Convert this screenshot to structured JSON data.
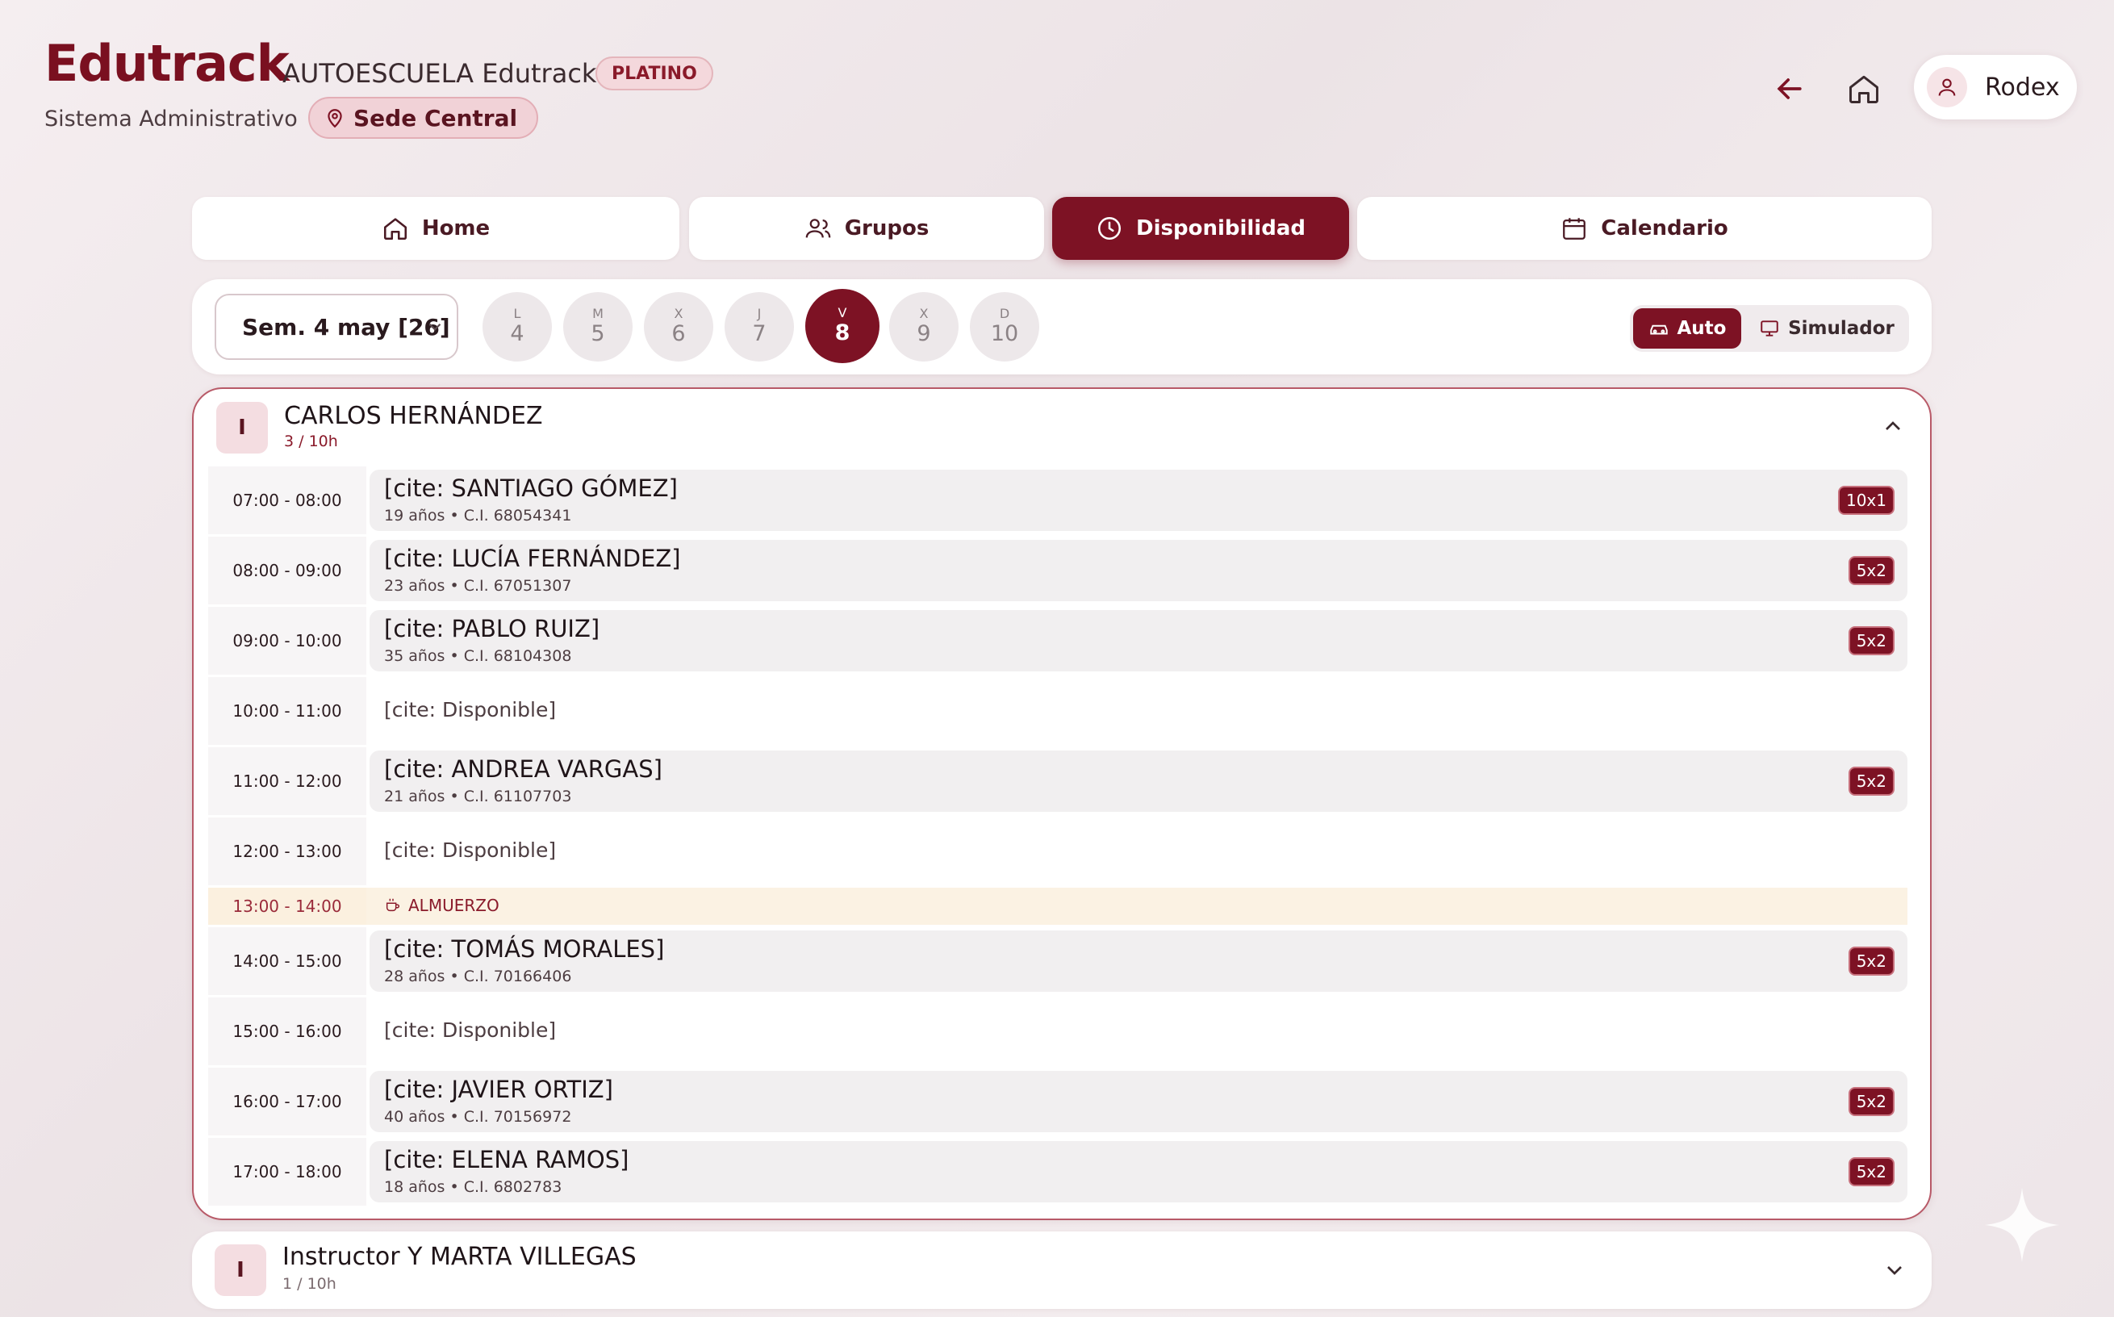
{
  "header": {
    "logo": "Edutrack",
    "school_name": "AUTOESCUELA Edutrack",
    "plan": "PLATINO",
    "subtitle": "Sistema Administrativo",
    "sede": "Sede Central",
    "user_name": "Rodex"
  },
  "tabs": [
    {
      "label": "Home",
      "icon": "home-icon"
    },
    {
      "label": "Grupos",
      "icon": "users-icon"
    },
    {
      "label": "Disponibilidad",
      "icon": "clock-icon",
      "active": true
    },
    {
      "label": "Calendario",
      "icon": "calendar-icon"
    }
  ],
  "week": {
    "selected": "Sem. 4 may [26]",
    "days": [
      {
        "letter": "L",
        "num": "4"
      },
      {
        "letter": "M",
        "num": "5"
      },
      {
        "letter": "X",
        "num": "6"
      },
      {
        "letter": "J",
        "num": "7"
      },
      {
        "letter": "V",
        "num": "8",
        "active": true
      },
      {
        "letter": "X",
        "num": "9"
      },
      {
        "letter": "D",
        "num": "10"
      }
    ]
  },
  "modes": {
    "auto": "Auto",
    "simulator": "Simulador"
  },
  "instructor1": {
    "initial": "I",
    "name": "CARLOS HERNÁNDEZ",
    "hours": "3 / 10h",
    "slots": [
      {
        "time": "07:00 - 08:00",
        "name": "[cite: SANTIAGO GÓMEZ]",
        "meta": "19 años • C.I. 68054341",
        "badge": "10x1"
      },
      {
        "time": "08:00 - 09:00",
        "name": "[cite: LUCÍA FERNÁNDEZ]",
        "meta": "23 años • C.I. 67051307",
        "badge": "5x2"
      },
      {
        "time": "09:00 - 10:00",
        "name": "[cite: PABLO RUIZ]",
        "meta": "35 años • C.I. 68104308",
        "badge": "5x2"
      },
      {
        "time": "10:00 - 11:00",
        "free": "[cite: Disponible]"
      },
      {
        "time": "11:00 - 12:00",
        "name": "[cite: ANDREA VARGAS]",
        "meta": "21 años • C.I. 61107703",
        "badge": "5x2"
      },
      {
        "time": "12:00 - 13:00",
        "free": "[cite: Disponible]"
      },
      {
        "time": "13:00 - 14:00",
        "lunch": "ALMUERZO"
      },
      {
        "time": "14:00 - 15:00",
        "name": "[cite: TOMÁS MORALES]",
        "meta": "28 años • C.I. 70166406",
        "badge": "5x2"
      },
      {
        "time": "15:00 - 16:00",
        "free": "[cite: Disponible]"
      },
      {
        "time": "16:00 - 17:00",
        "name": "[cite: JAVIER ORTIZ]",
        "meta": "40 años • C.I. 70156972",
        "badge": "5x2"
      },
      {
        "time": "17:00 - 18:00",
        "name": "[cite: ELENA RAMOS]",
        "meta": "18 años • C.I. 6802783",
        "badge": "5x2"
      }
    ]
  },
  "instructor2": {
    "initial": "I",
    "name": "Instructor Y MARTA VILLEGAS",
    "hours": "1 / 10h"
  },
  "colors": {
    "accent": "#7d1224",
    "lunch_bg": "#fbf2e3"
  }
}
